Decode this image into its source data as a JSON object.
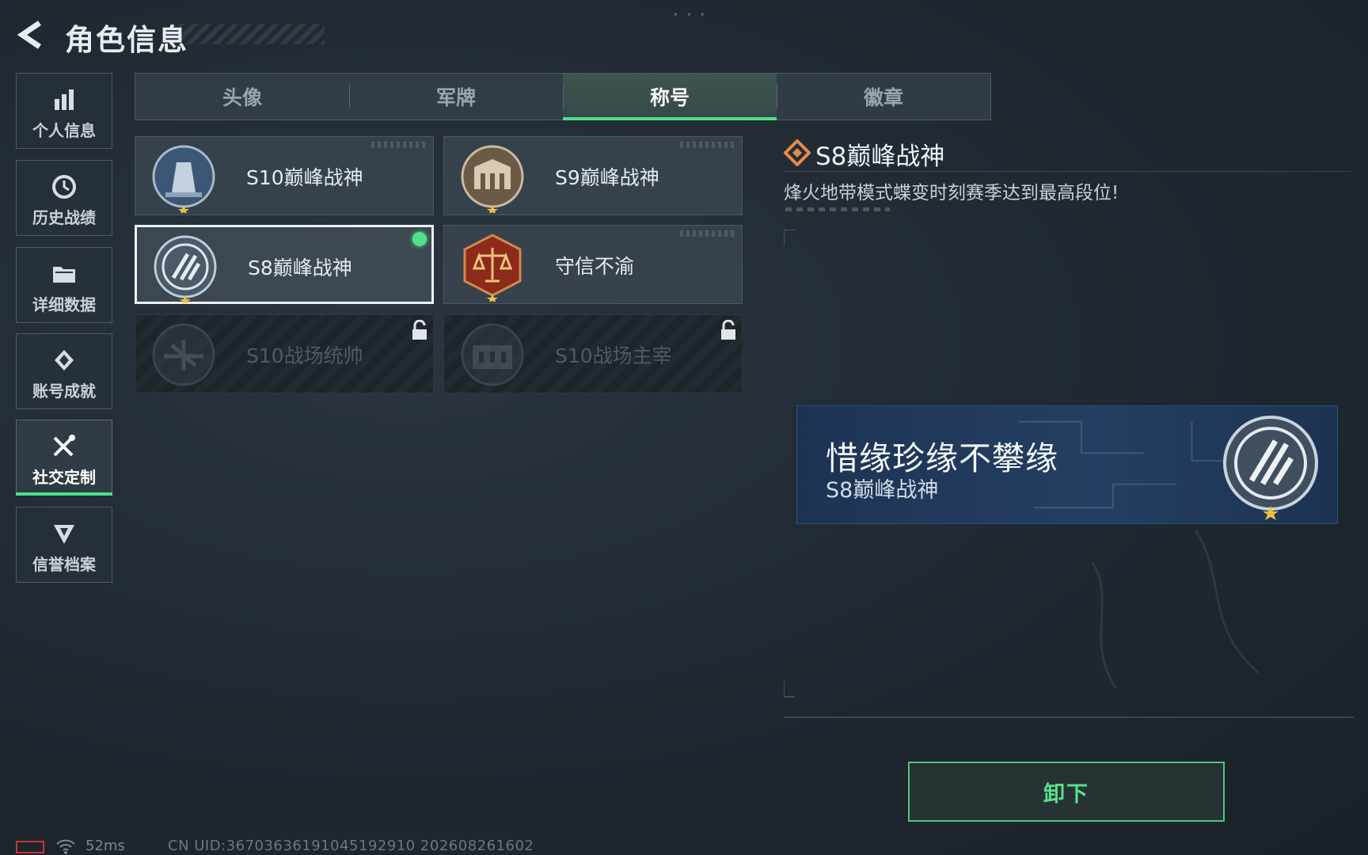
{
  "header": {
    "title": "角色信息"
  },
  "sidebar": {
    "items": [
      {
        "label": "个人信息",
        "icon": "bar-chart-icon"
      },
      {
        "label": "历史战绩",
        "icon": "clock-icon"
      },
      {
        "label": "详细数据",
        "icon": "folder-icon"
      },
      {
        "label": "账号成就",
        "icon": "achievement-icon"
      },
      {
        "label": "社交定制",
        "icon": "tools-icon",
        "active": true
      },
      {
        "label": "信誉档案",
        "icon": "shield-icon"
      }
    ]
  },
  "tabs": [
    {
      "label": "头像"
    },
    {
      "label": "军牌"
    },
    {
      "label": "称号",
      "active": true
    },
    {
      "label": "徽章"
    }
  ],
  "titles": [
    {
      "name": "S10巅峰战神",
      "state": "unlocked"
    },
    {
      "name": "S9巅峰战神",
      "state": "unlocked"
    },
    {
      "name": "S8巅峰战神",
      "state": "equipped"
    },
    {
      "name": "守信不渝",
      "state": "unlocked"
    },
    {
      "name": "S10战场统帅",
      "state": "locked"
    },
    {
      "name": "S10战场主宰",
      "state": "locked"
    }
  ],
  "detail": {
    "title": "S8巅峰战神",
    "description": "烽火地带模式蝶变时刻赛季达到最高段位!"
  },
  "preview": {
    "player_name": "惜缘珍缘不攀缘",
    "title": "S8巅峰战神"
  },
  "actions": {
    "unequip_label": "卸下"
  },
  "footer": {
    "ping": "52ms",
    "uid": "CN UID:367036361910451929​10 202608261602"
  },
  "colors": {
    "accent": "#4ee08a",
    "preview_bg": "#243f63"
  }
}
